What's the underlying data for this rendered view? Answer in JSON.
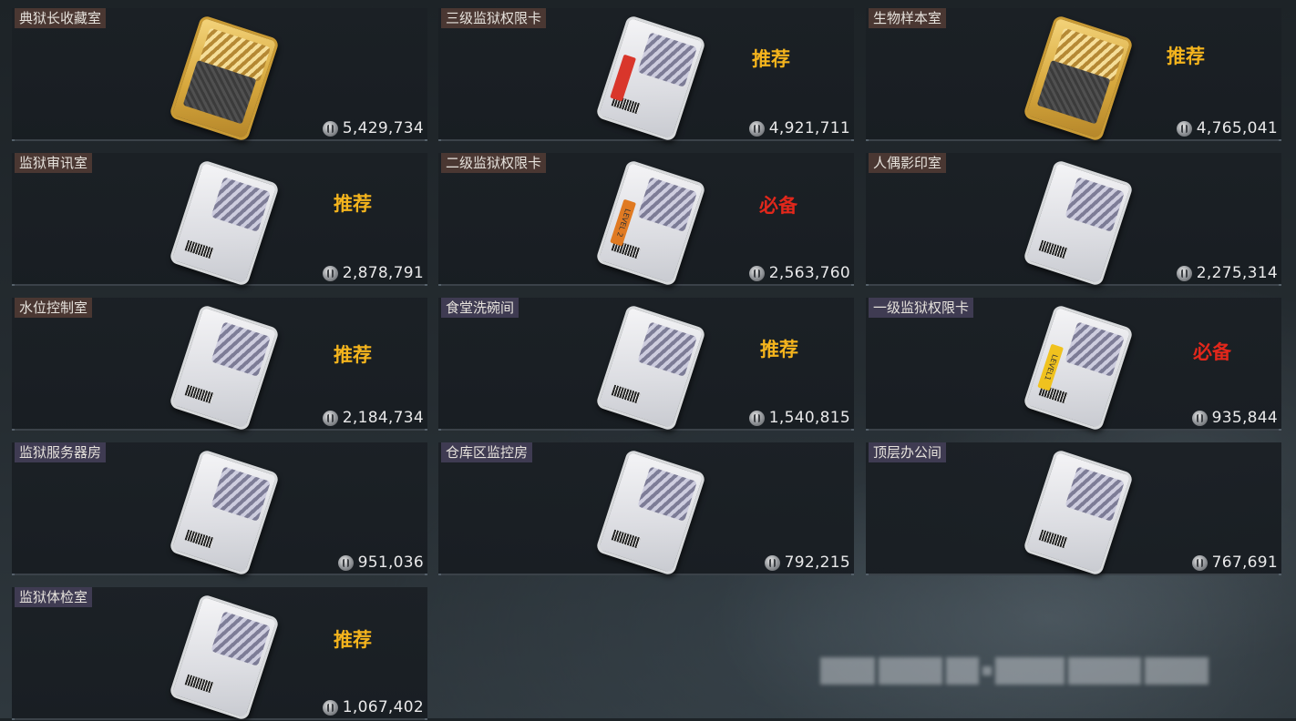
{
  "tiles": [
    {
      "name": "典狱长收藏室",
      "tag_color": "brown",
      "card": "gold",
      "stripe": "",
      "stripe_color": "",
      "badge": "",
      "badge_type": "",
      "price": "5,429,734"
    },
    {
      "name": "三级监狱权限卡",
      "tag_color": "brown",
      "card": "white",
      "stripe": "",
      "stripe_color": "red",
      "badge": "推荐",
      "badge_type": "rec",
      "price": "4,921,711"
    },
    {
      "name": "生物样本室",
      "tag_color": "brown",
      "card": "gold",
      "stripe": "",
      "stripe_color": "",
      "badge": "推荐",
      "badge_type": "rec",
      "price": "4,765,041"
    },
    {
      "name": "监狱审讯室",
      "tag_color": "brown",
      "card": "white",
      "stripe": "",
      "stripe_color": "",
      "badge": "推荐",
      "badge_type": "rec",
      "price": "2,878,791"
    },
    {
      "name": "二级监狱权限卡",
      "tag_color": "brown",
      "card": "white",
      "stripe": "LEVEL 2",
      "stripe_color": "orange",
      "badge": "必备",
      "badge_type": "must",
      "price": "2,563,760"
    },
    {
      "name": "人偶影印室",
      "tag_color": "brown",
      "card": "white",
      "stripe": "",
      "stripe_color": "",
      "badge": "",
      "badge_type": "",
      "price": "2,275,314"
    },
    {
      "name": "水位控制室",
      "tag_color": "brown",
      "card": "white",
      "stripe": "",
      "stripe_color": "",
      "badge": "推荐",
      "badge_type": "rec",
      "price": "2,184,734"
    },
    {
      "name": "食堂洗碗间",
      "tag_color": "purple",
      "card": "white",
      "stripe": "",
      "stripe_color": "",
      "badge": "推荐",
      "badge_type": "rec",
      "price": "1,540,815"
    },
    {
      "name": "一级监狱权限卡",
      "tag_color": "purple",
      "card": "white",
      "stripe": "LEVEL1",
      "stripe_color": "yellow",
      "badge": "必备",
      "badge_type": "must",
      "price": "935,844"
    },
    {
      "name": "监狱服务器房",
      "tag_color": "purple",
      "card": "white",
      "stripe": "",
      "stripe_color": "",
      "badge": "",
      "badge_type": "",
      "price": "951,036"
    },
    {
      "name": "仓库区监控房",
      "tag_color": "purple",
      "card": "white",
      "stripe": "",
      "stripe_color": "",
      "badge": "",
      "badge_type": "",
      "price": "792,215"
    },
    {
      "name": "顶层办公间",
      "tag_color": "purple",
      "card": "white",
      "stripe": "",
      "stripe_color": "",
      "badge": "",
      "badge_type": "",
      "price": "767,691"
    },
    {
      "name": "监狱体检室",
      "tag_color": "purple",
      "card": "white",
      "stripe": "",
      "stripe_color": "",
      "badge": "推荐",
      "badge_type": "rec",
      "price": "1,067,402"
    }
  ],
  "icons": {
    "price": "coin-icon"
  },
  "colors": {
    "recommend": "#f4b41d",
    "essential": "#e2271b",
    "tag_brown": "#4a3732",
    "tag_purple": "#3f3b52"
  }
}
